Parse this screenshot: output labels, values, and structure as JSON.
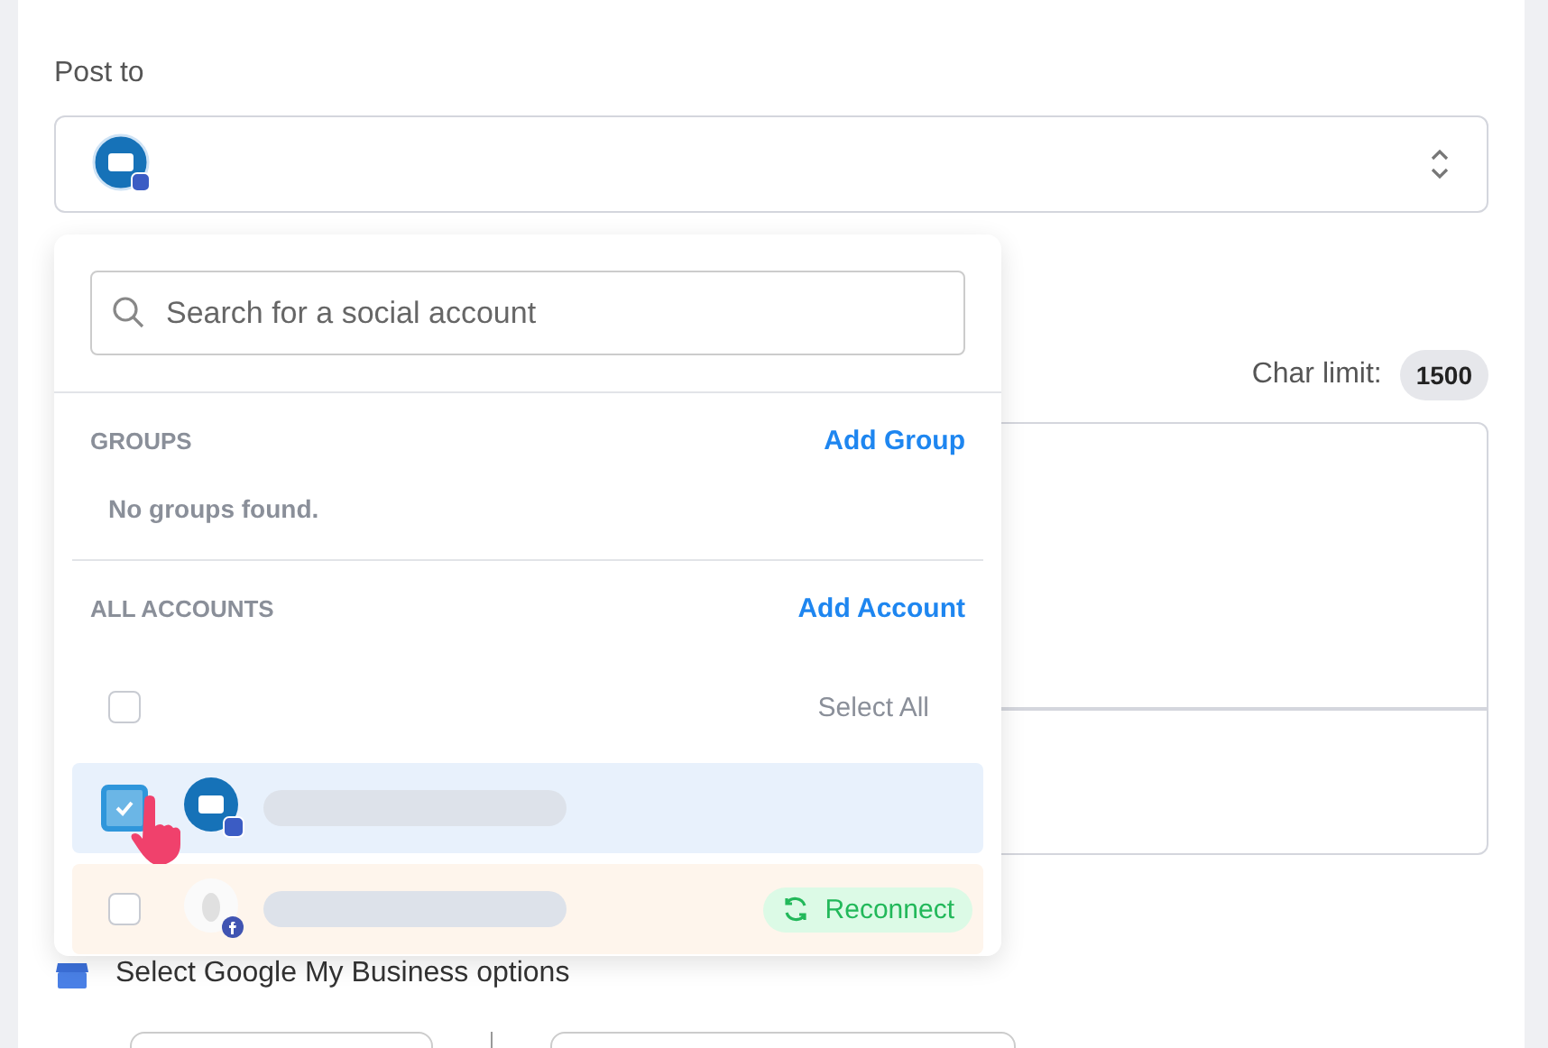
{
  "post_to": {
    "label": "Post to"
  },
  "char_limit": {
    "label": "Char limit:",
    "value": "1500"
  },
  "dropdown": {
    "search": {
      "placeholder": "Search for a social account"
    },
    "groups": {
      "heading": "GROUPS",
      "action": "Add Group",
      "empty": "No groups found."
    },
    "accounts": {
      "heading": "ALL ACCOUNTS",
      "action": "Add Account",
      "select_all": {
        "label": "Select All",
        "checked": false
      },
      "items": [
        {
          "kind": "business",
          "checked": true,
          "selected": true,
          "needs_reconnect": false
        },
        {
          "kind": "facebook",
          "checked": false,
          "selected": false,
          "needs_reconnect": true,
          "action": "Reconnect"
        }
      ]
    }
  },
  "gmb_options": {
    "label": "Select Google My Business options"
  }
}
